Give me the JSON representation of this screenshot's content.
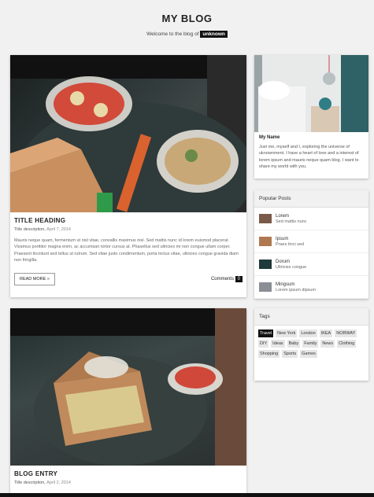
{
  "header": {
    "title": "MY BLOG",
    "welcome_text": "Welcome to the blog of",
    "blog_owner": "unknown"
  },
  "posts": [
    {
      "title": "TITLE HEADING",
      "description": "Title description,",
      "date": "April 7, 2014",
      "text": "Mauris neque quam, fermentum ut nisl vitae, convallis maximus nisl. Sed mattis nunc id lorem euismod placerat. Vivamus porttitor magna enim, ac accumsan tortor cursus at. Phasellus sed ultricies mi non congue ullam corper. Praesent tincidunt sed tellus ut rutrum. Sed vitae justo condimentum, porta lectus vitae, ultricies congue gravida diam non fringilla.",
      "read_more": "READ MORE »",
      "comments_label": "Comments",
      "comments_count": "0"
    },
    {
      "title": "BLOG ENTRY",
      "description": "Title description,",
      "date": "April 2, 2014"
    }
  ],
  "about": {
    "name": "My Name",
    "text": "Just me, myself and I, exploring the universe of uknownment. I have a heart of love and a interest of lorem ipsum and mauris neque quam blog. I want to share my world with you."
  },
  "popular": {
    "heading": "Popular Posts",
    "items": [
      {
        "title": "Lorem",
        "subtitle": "Sed mattis nunc",
        "thumb_color": "#7a5a48"
      },
      {
        "title": "Ipsum",
        "subtitle": "Praes tinci sed",
        "thumb_color": "#b07850"
      },
      {
        "title": "Dorum",
        "subtitle": "Ultricies congue",
        "thumb_color": "#1e3a3a"
      },
      {
        "title": "Mingsum",
        "subtitle": "Lorem ipsum dipsum",
        "thumb_color": "#8a8f95"
      }
    ]
  },
  "tags": {
    "heading": "Tags",
    "items": [
      "Travel",
      "New York",
      "London",
      "IKEA",
      "NORWAY",
      "DIY",
      "Ideas",
      "Baby",
      "Family",
      "News",
      "Clothing",
      "Shopping",
      "Sports",
      "Games"
    ],
    "active": "Travel"
  }
}
